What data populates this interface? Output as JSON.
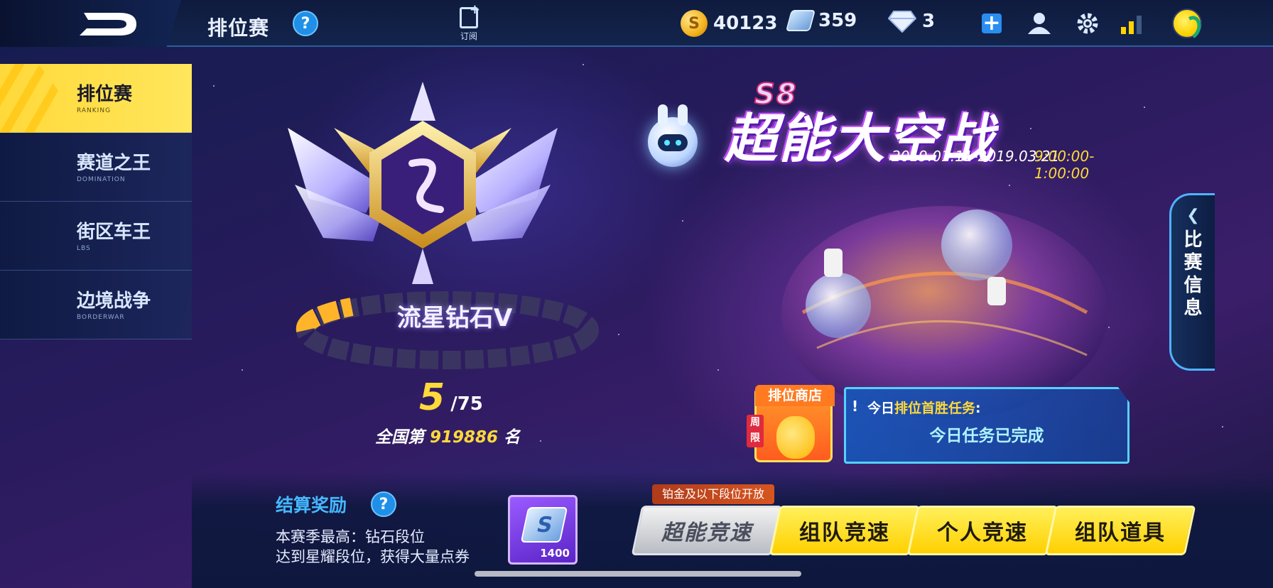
{
  "header": {
    "page_title": "排位赛",
    "help_label": "?",
    "subscribe_label": "订阅",
    "currencies": {
      "coins": "40123",
      "tickets": "359",
      "diamonds": "3"
    },
    "icons": [
      "coin-icon",
      "ticket-icon",
      "diamond-icon",
      "add-icon",
      "friends-icon",
      "gear-icon",
      "signal-icon",
      "avatar"
    ]
  },
  "sidebar": {
    "items": [
      {
        "zh": "排位赛",
        "en": "RANKING",
        "active": true
      },
      {
        "zh": "赛道之王",
        "en": "DOMINATION",
        "active": false
      },
      {
        "zh": "街区车王",
        "en": "LBS",
        "active": false
      },
      {
        "zh": "边境战争",
        "en": "BORDERWAR",
        "active": false
      }
    ]
  },
  "rank": {
    "name": "流星钻石V",
    "stars_current": "5",
    "stars_separator": "/",
    "stars_total": "75",
    "national_prefix": "全国第",
    "national_rank": "919886",
    "national_suffix": "名"
  },
  "season": {
    "tag": "S8",
    "title": "超能大空战",
    "dates": "2019.01.11-2019.03.21",
    "time": "9:00:00-1:00:00"
  },
  "side_tab": {
    "arrow": "❮",
    "label_lines": [
      "比",
      "赛",
      "信",
      "息"
    ]
  },
  "shop": {
    "label": "排位商店",
    "badge": "周限"
  },
  "task": {
    "bang": "!",
    "prefix": "今日",
    "highlight": "排位首胜任务",
    "suffix": ":",
    "status": "今日任务已完成"
  },
  "reward": {
    "title": "结算奖励",
    "help_label": "?",
    "line1": "本赛季最高：钻石段位",
    "line2": "达到星耀段位，获得大量点券",
    "item_count": "1400"
  },
  "modes": {
    "note": "铂金及以下段位开放",
    "buttons": [
      {
        "label": "超能竞速",
        "style": "gray"
      },
      {
        "label": "组队竞速",
        "style": "yellow"
      },
      {
        "label": "个人竞速",
        "style": "yellow"
      },
      {
        "label": "组队道具",
        "style": "yellow"
      }
    ]
  },
  "colors": {
    "accent_yellow": "#ffd93a",
    "accent_blue": "#45b8ff",
    "header_bg": "#13244c"
  }
}
